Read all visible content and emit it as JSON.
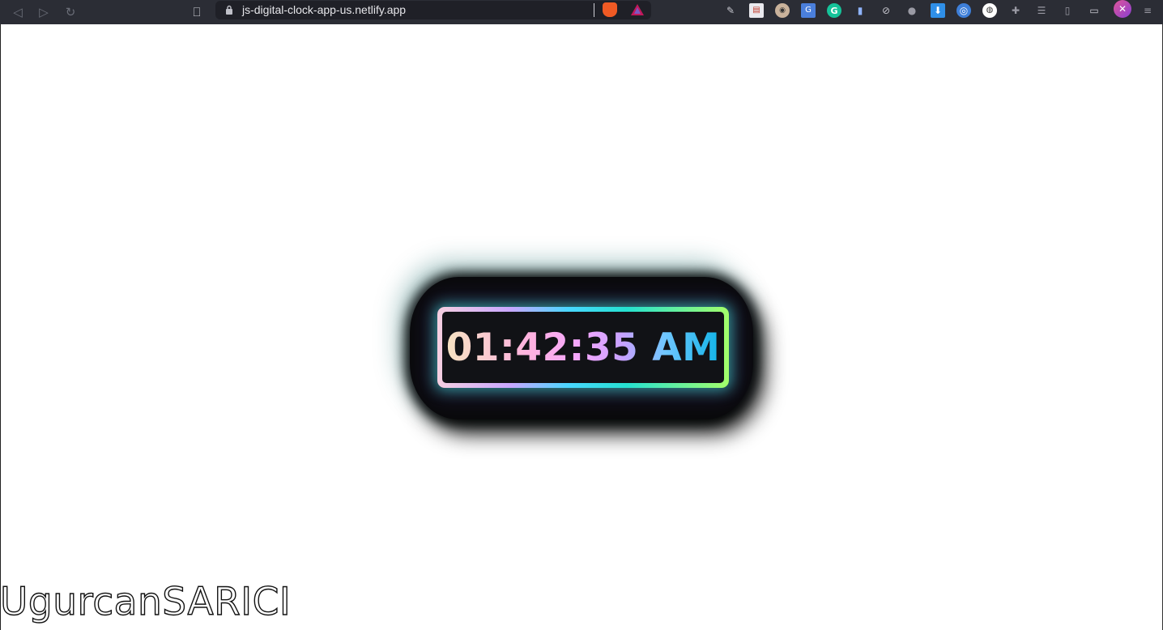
{
  "browser": {
    "url": "js-digital-clock-app-us.netlify.app",
    "nav": {
      "back_icon": "◁",
      "forward_icon": "▷",
      "reload_icon": "↻",
      "bookmark_icon": "⎕"
    },
    "extensions": [
      {
        "name": "brave-shield-icon",
        "glyph": "🦁"
      },
      {
        "name": "brave-rewards-icon",
        "glyph": "▲"
      },
      {
        "name": "pen-icon",
        "glyph": "✎"
      },
      {
        "name": "notes-icon",
        "glyph": "▤"
      },
      {
        "name": "owl-icon",
        "glyph": "◉"
      },
      {
        "name": "translate-icon",
        "glyph": "G"
      },
      {
        "name": "grammarly-icon",
        "glyph": "G"
      },
      {
        "name": "docs-icon",
        "glyph": "▮"
      },
      {
        "name": "compass-icon",
        "glyph": "⊘"
      },
      {
        "name": "bottle-icon",
        "glyph": "●"
      },
      {
        "name": "download-icon",
        "glyph": "⬇"
      },
      {
        "name": "circle-extension-icon",
        "glyph": "◎"
      },
      {
        "name": "dots-extension-icon",
        "glyph": "◍"
      },
      {
        "name": "puzzle-icon",
        "glyph": "✚"
      },
      {
        "name": "playlist-icon",
        "glyph": "☰"
      },
      {
        "name": "sidebar-icon",
        "glyph": "▯"
      },
      {
        "name": "wallet-icon",
        "glyph": "▭"
      },
      {
        "name": "profile-avatar-icon",
        "glyph": "✕"
      },
      {
        "name": "menu-icon",
        "glyph": "≡"
      }
    ]
  },
  "clock": {
    "time": "01:42:35 AM"
  },
  "watermark": "UgurcanSARICI",
  "colors": {
    "chrome_bg": "#2b2d35",
    "urlbar_bg": "#1f2027",
    "clock_face": "#111216",
    "frame_gradient": [
      "#f5cfe0",
      "#c9a7ff",
      "#49d7ff",
      "#25e1d0",
      "#a4ff6a"
    ]
  }
}
